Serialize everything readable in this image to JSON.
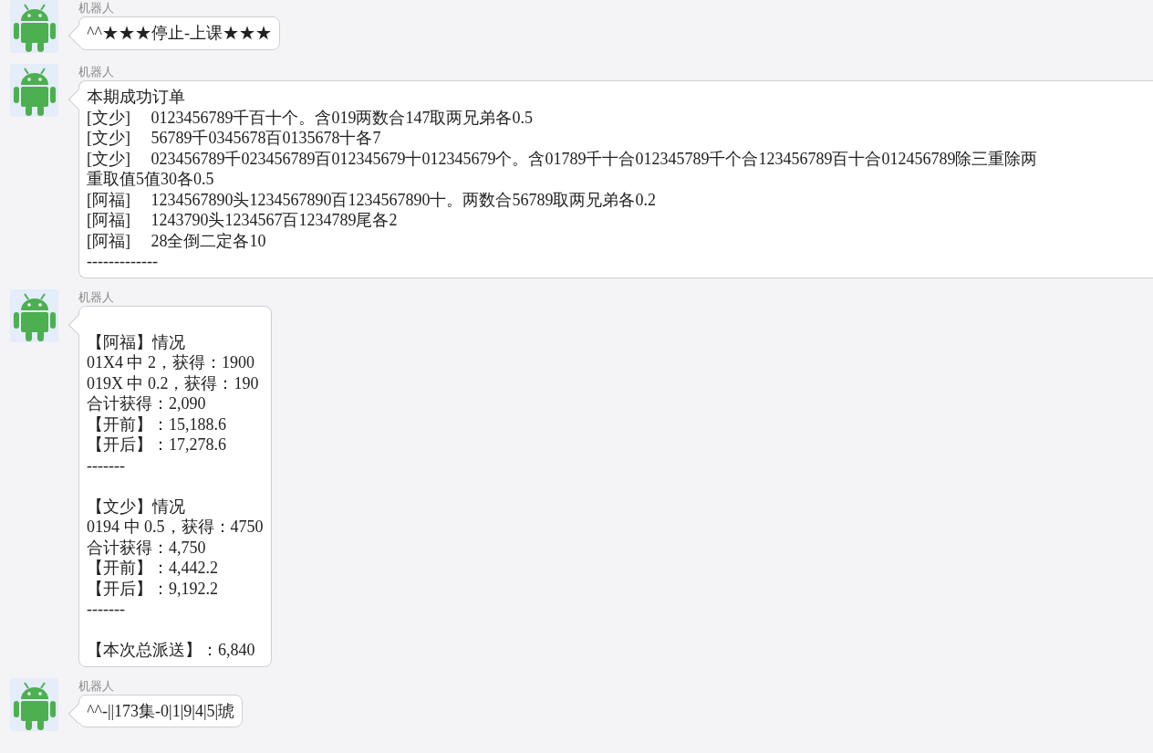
{
  "messages": [
    {
      "sender": "机器人",
      "leading_blank": false,
      "wide": false,
      "paragraphs": [
        [
          "^^★★★停止-上课★★★"
        ]
      ]
    },
    {
      "sender": "机器人",
      "leading_blank": false,
      "wide": true,
      "paragraphs": [
        [
          "本期成功订单",
          "[文少]　 0123456789千百十个。含019两数合147取两兄弟各0.5",
          "[文少]　 56789千0345678百0135678十各7",
          "[文少]　 023456789千023456789百012345679十012345679个。含01789千十合012345789千个合123456789百十合012456789除三重除两",
          "重取值5值30各0.5",
          "[阿福]　 1234567890头1234567890百1234567890十。两数合56789取两兄弟各0.2",
          "[阿福]　 1243790头1234567百1234789尾各2",
          "[阿福]　 28全倒二定各10",
          "-------------"
        ]
      ]
    },
    {
      "sender": "机器人",
      "leading_blank": true,
      "wide": false,
      "paragraphs": [
        [
          "【阿福】情况",
          "01X4 中 2，获得：1900",
          "019X 中 0.2，获得：190",
          "合计获得：2,090",
          "【开前】：15,188.6",
          "【开后】：17,278.6",
          "-------"
        ],
        [
          "【文少】情况",
          "0194 中 0.5，获得：4750",
          "合计获得：4,750",
          "【开前】：4,442.2",
          "【开后】：9,192.2",
          "-------"
        ],
        [
          "【本次总派送】：6,840"
        ]
      ]
    },
    {
      "sender": "机器人",
      "leading_blank": false,
      "wide": false,
      "paragraphs": [
        [
          "^^-||173集-0|1|9|4|5|琥"
        ]
      ]
    }
  ]
}
